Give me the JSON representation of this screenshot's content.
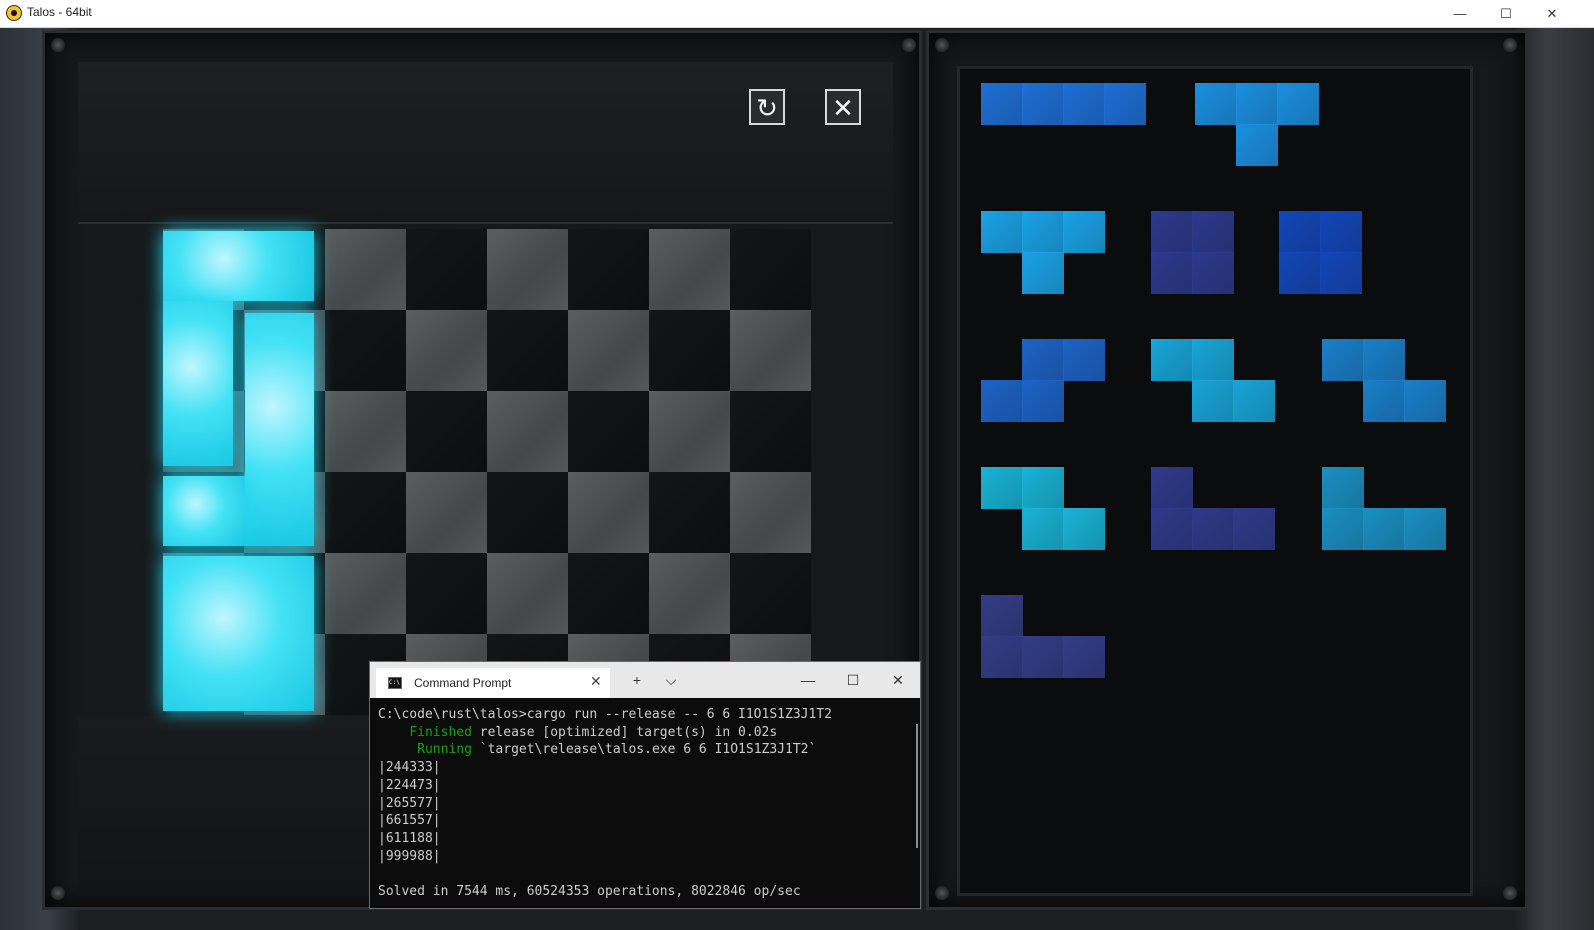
{
  "window": {
    "title": "Talos - 64bit",
    "minimize": "—",
    "maximize": "☐",
    "close": "✕"
  },
  "game": {
    "undo_icon": "↻",
    "close_icon": "✕",
    "board": {
      "rows": 6,
      "cols": 8
    },
    "pieces": [
      {
        "type": "I",
        "color": "#1e6fd6"
      },
      {
        "type": "T",
        "color": "#1b8fe0"
      },
      {
        "type": "T",
        "color": "#1aa2e6"
      },
      {
        "type": "O",
        "color": "#2b3a8c"
      },
      {
        "type": "O",
        "color": "#1347b8"
      },
      {
        "type": "S",
        "color": "#1d63c6"
      },
      {
        "type": "Z",
        "color": "#18a5d8"
      },
      {
        "type": "Z",
        "color": "#1a7fc9"
      },
      {
        "type": "Z",
        "color": "#19b3d6"
      },
      {
        "type": "L",
        "color": "#2f3a8a"
      },
      {
        "type": "L",
        "color": "#1a8fc2"
      },
      {
        "type": "L",
        "color": "#333d86"
      }
    ]
  },
  "terminal": {
    "tab_title": "Command Prompt",
    "tab_close": "✕",
    "new_tab": "+",
    "dropdown": "⌵",
    "minimize": "—",
    "maximize": "☐",
    "close": "✕",
    "command_line": "C:\\code\\rust\\talos>cargo run --release -- 6 6 I1O1S1Z3J1T2",
    "finished_label": "Finished",
    "finished_text": " release [optimized] target(s) in 0.02s",
    "running_label": "Running",
    "running_text": " `target\\release\\talos.exe 6 6 I1O1S1Z3J1T2`",
    "grid_lines": [
      "|244333|",
      "|224473|",
      "|265577|",
      "|661557|",
      "|611188|",
      "|999988|"
    ],
    "result": "Solved in 7544 ms, 60524353 operations, 8022846 op/sec"
  }
}
